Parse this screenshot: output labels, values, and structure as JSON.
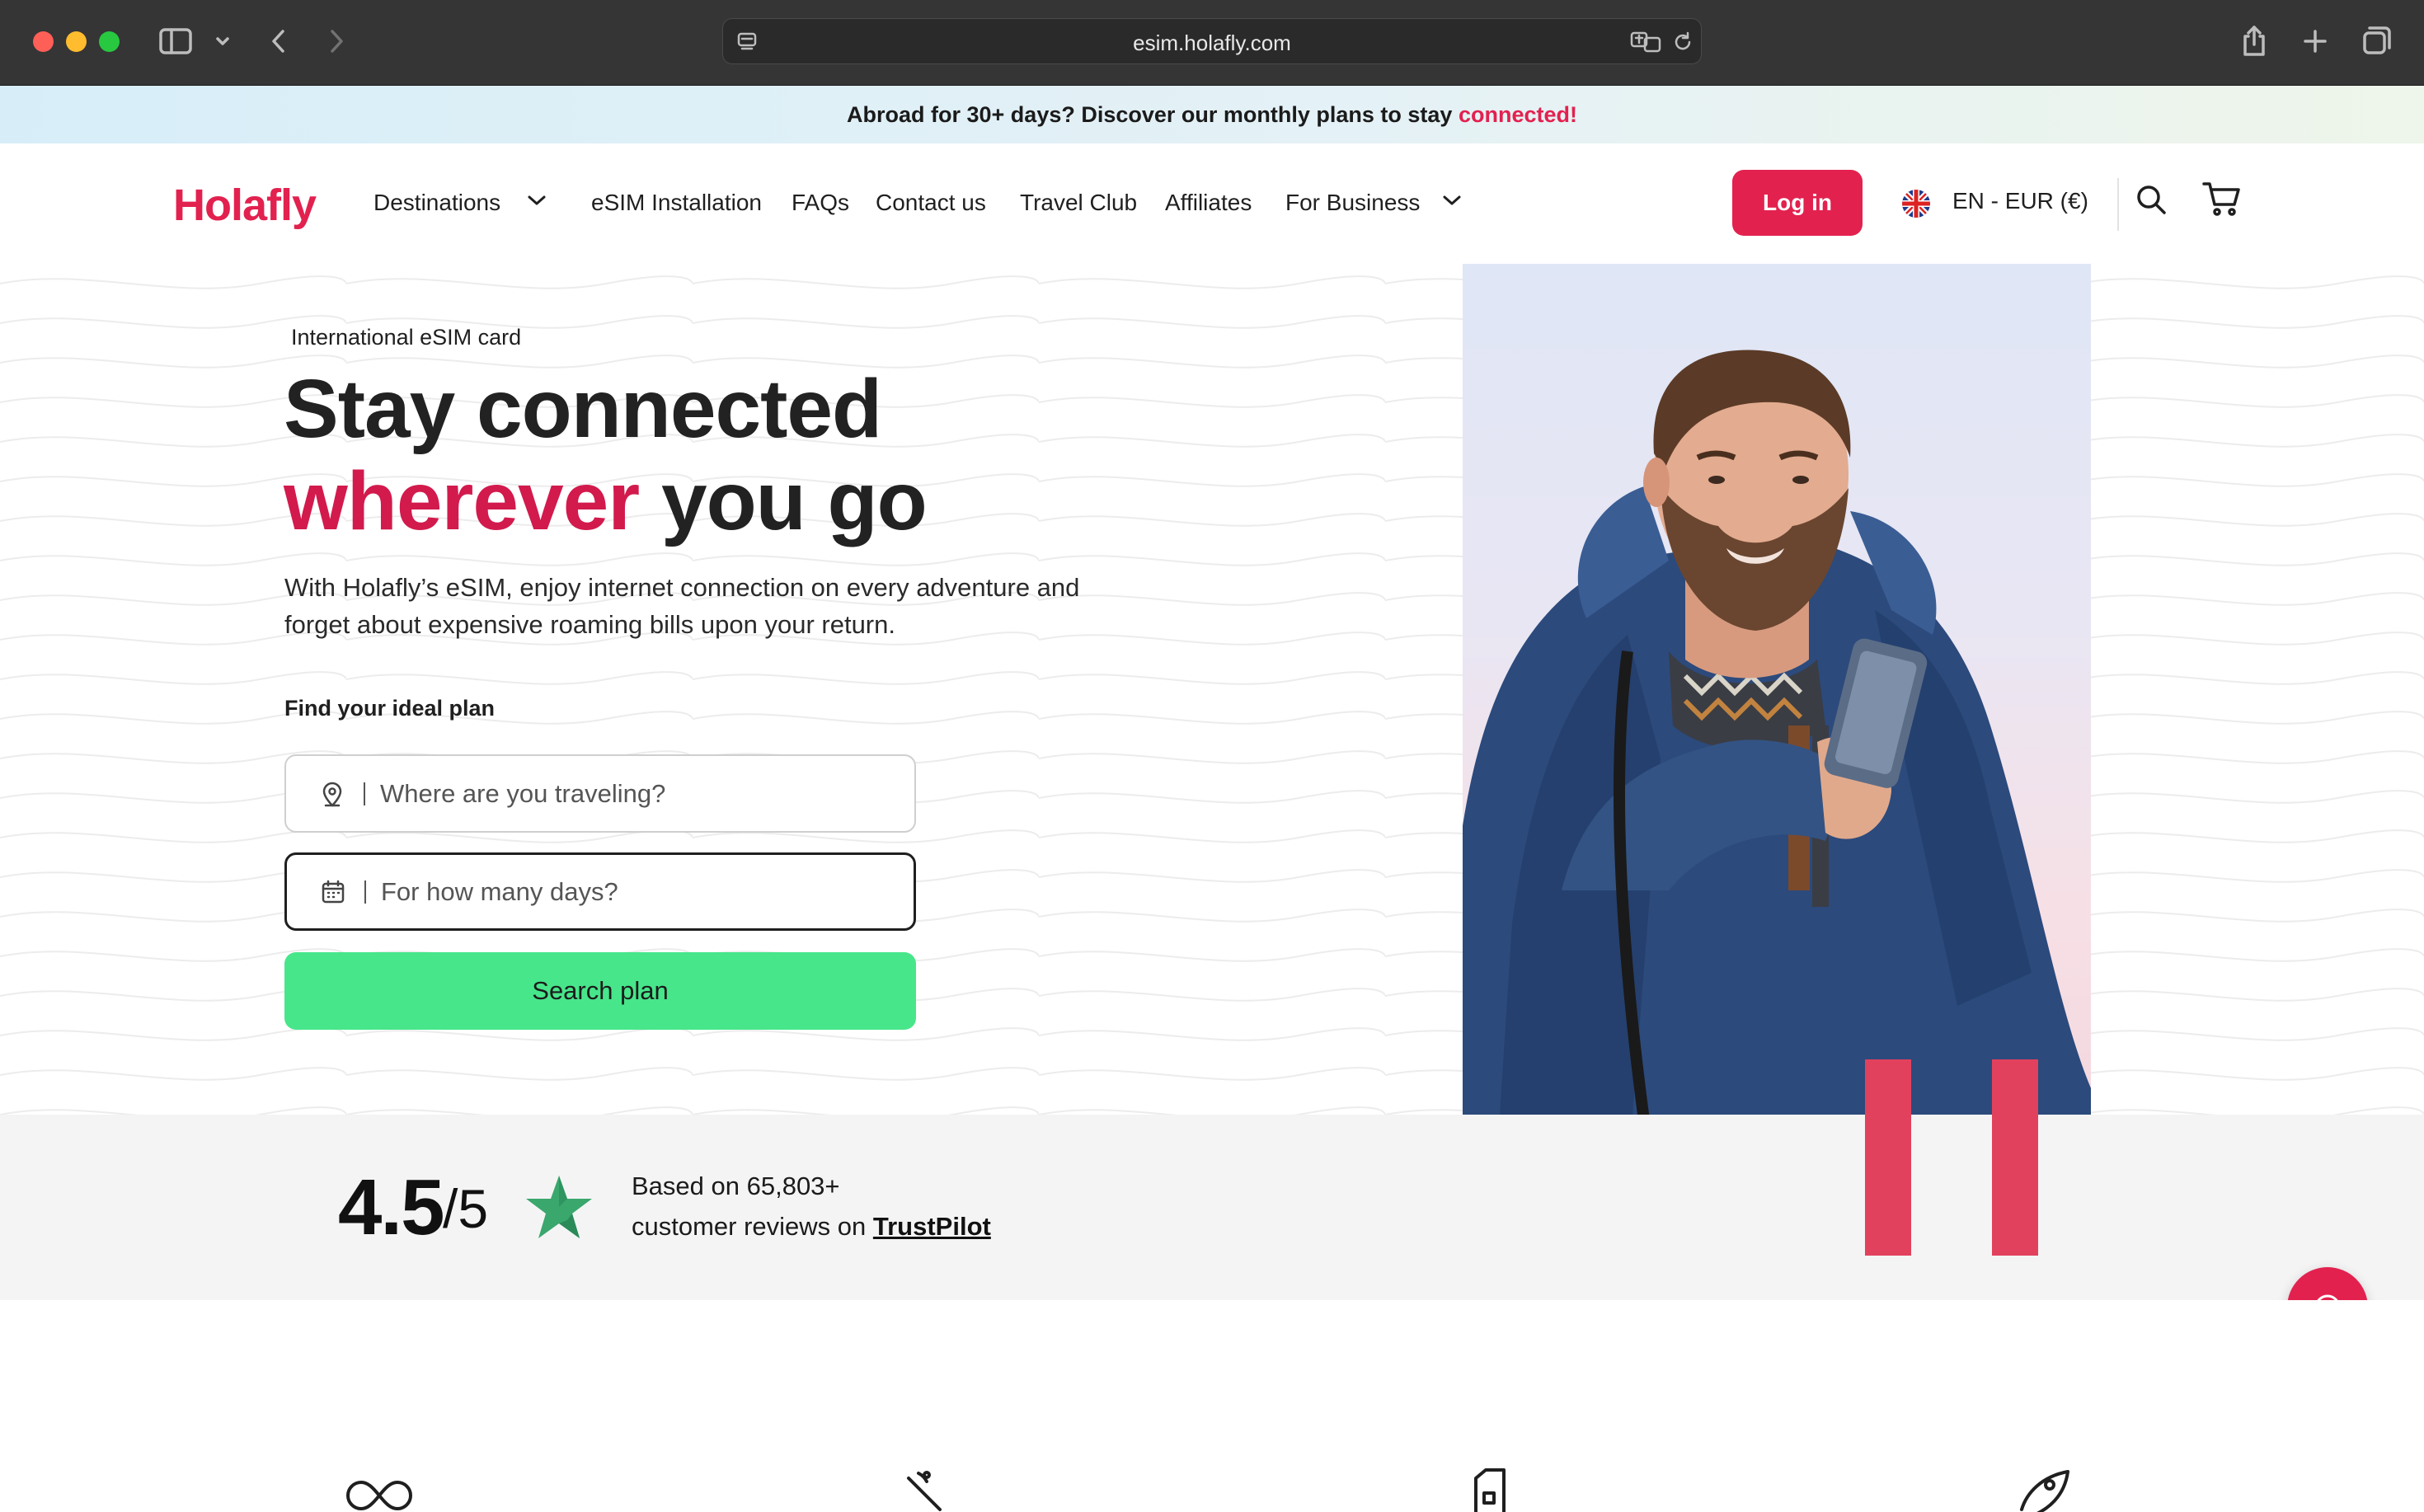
{
  "browser": {
    "url": "esim.holafly.com"
  },
  "announcement": {
    "text": "Abroad for 30+ days? Discover our monthly plans to stay ",
    "accent": "connected!"
  },
  "header": {
    "logo": "Holafly",
    "nav": {
      "destinations": "Destinations",
      "installation": "eSIM Installation",
      "faqs": "FAQs",
      "contact": "Contact us",
      "travel_club": "Travel Club",
      "affiliates": "Affiliates",
      "business": "For Business"
    },
    "login": "Log in",
    "language": "EN - EUR (€)"
  },
  "hero": {
    "eyebrow": "International eSIM card",
    "headline_line1": "Stay connected",
    "headline_accent": "wherever",
    "headline_rest": " you go",
    "subcopy": "With Holafly’s eSIM, enjoy internet connection on every adventure and forget about expensive roaming bills upon your return.",
    "find_label": "Find your ideal plan",
    "destination_placeholder": "Where are you traveling?",
    "days_placeholder": "For how many days?",
    "search_button": "Search plan"
  },
  "rating": {
    "score": "4.5",
    "out_of": "/5",
    "line1": "Based on 65,803+",
    "line2": "customer reviews on ",
    "trustpilot": "TrustPilot"
  },
  "colors": {
    "brand": "#e2214f",
    "cta": "#47e68a",
    "star": "#3aa76d"
  }
}
